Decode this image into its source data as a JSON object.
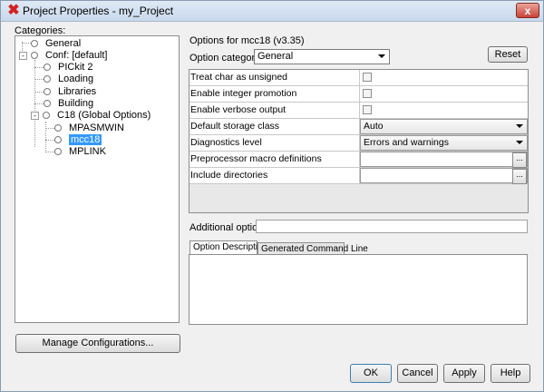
{
  "window": {
    "title": "Project Properties - my_Project",
    "close_label": "x"
  },
  "categories": {
    "label": "Categories:",
    "tree": [
      {
        "label": "General"
      },
      {
        "label": "Conf: [default]",
        "expander": "-"
      },
      {
        "label": "PICkit 2"
      },
      {
        "label": "Loading"
      },
      {
        "label": "Libraries"
      },
      {
        "label": "Building"
      },
      {
        "label": "C18 (Global Options)",
        "expander": "-"
      },
      {
        "label": "MPASMWIN"
      },
      {
        "label": "mcc18",
        "selected": true
      },
      {
        "label": "MPLINK"
      }
    ],
    "manage_button": "Manage Configurations..."
  },
  "options": {
    "header": "Options for mcc18 (v3.35)",
    "category_label": "Option categories:",
    "category_value": "General",
    "reset_button": "Reset",
    "rows": [
      {
        "name": "Treat char as unsigned",
        "type": "checkbox",
        "checked": false
      },
      {
        "name": "Enable integer promotion",
        "type": "checkbox",
        "checked": false
      },
      {
        "name": "Enable verbose output",
        "type": "checkbox",
        "checked": false
      },
      {
        "name": "Default storage class",
        "type": "combo",
        "value": "Auto"
      },
      {
        "name": "Diagnostics level",
        "type": "combo",
        "value": "Errors and warnings"
      },
      {
        "name": "Preprocessor macro definitions",
        "type": "text",
        "value": "",
        "button": "..."
      },
      {
        "name": "Include directories",
        "type": "text",
        "value": "",
        "button": "..."
      }
    ],
    "additional_label": "Additional options:",
    "additional_value": ""
  },
  "tabs": [
    {
      "label": "Option Description",
      "active": true
    },
    {
      "label": "Generated Command Line",
      "active": false
    }
  ],
  "buttons": {
    "ok": "OK",
    "cancel": "Cancel",
    "apply": "Apply",
    "help": "Help"
  }
}
